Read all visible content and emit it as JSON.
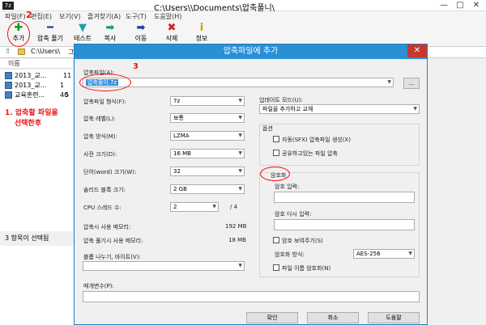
{
  "window": {
    "icon_text": "7z",
    "title": "C:\\Users\\",
    "title_path": "\\Documents\\압축풀니\\",
    "controls": [
      "—",
      "□",
      "✕"
    ]
  },
  "menu": [
    "파일(F)",
    "편집(E)",
    "보기(V)",
    "즐겨찾기(A)",
    "도구(T)",
    "도움말(H)"
  ],
  "toolbar": [
    {
      "label": "추가",
      "icon": "plus-icon",
      "glyph": "✚",
      "color": "#1a9a1a"
    },
    {
      "label": "압축 풀기",
      "icon": "minus-icon",
      "glyph": "━",
      "color": "#1a3aa0"
    },
    {
      "label": "테스트",
      "icon": "check-icon",
      "glyph": "▼",
      "color": "#1aa0b0"
    },
    {
      "label": "복사",
      "icon": "arrow-right-icon",
      "glyph": "➡",
      "color": "#1a9a6a"
    },
    {
      "label": "이동",
      "icon": "arrow-right-icon",
      "glyph": "➡",
      "color": "#1a3aa0"
    },
    {
      "label": "삭제",
      "icon": "delete-icon",
      "glyph": "✖",
      "color": "#d02020"
    },
    {
      "label": "정보",
      "icon": "info-icon",
      "glyph": "i",
      "color": "#d0a000"
    }
  ],
  "address": {
    "path": "C:\\Users\\",
    "path_end": "그"
  },
  "list": {
    "header": "이름",
    "rows": [
      {
        "name": "2013_교...",
        "size": "11"
      },
      {
        "name": "2013_교...",
        "size": "1 40"
      },
      {
        "name": "교육훈련...",
        "size": "5"
      }
    ]
  },
  "annotations": {
    "step1_line1": "1.  압축할  파일을",
    "step1_line2": "선택한후",
    "step2": "2",
    "step3": "3"
  },
  "status": {
    "text": "3 항목이 선택됨"
  },
  "dialog": {
    "title": "압축파일에 추가",
    "close": "✕",
    "archive_label": "압축파일(A):",
    "archive_value": "압축풀이.7z",
    "browse": "...",
    "format_label": "압축파일 형식(F):",
    "format_value": "7z",
    "level_label": "압축 레벨(L):",
    "level_value": "보통",
    "method_label": "압축 방식(M):",
    "method_value": "LZMA",
    "dict_label": "사전 크기(D):",
    "dict_value": "16 MB",
    "word_label": "단어(word) 크기(W):",
    "word_value": "32",
    "solid_label": "솔리드 블록 크기:",
    "solid_value": "2 GB",
    "cpu_label": "CPU 스레드 수:",
    "cpu_value": "2",
    "cpu_total": "/ 4",
    "mem_compress_label": "압축시 사용 메모리:",
    "mem_compress_value": "192 MB",
    "mem_decompress_label": "압축 풀기시 사용 메모리:",
    "mem_decompress_value": "18 MB",
    "split_label": "볼륨 나누기, 바이트(V):",
    "params_label": "매개변수(P):",
    "update_label": "업데이트 모드(U):",
    "update_value": "파일을 추가하고 교체",
    "options_label": "옵션",
    "sfx_label": "자동(SFX) 압축파일 생성(X)",
    "shared_label": "공유하고있는 파일 압축",
    "encrypt_label": "암호화",
    "pw_label": "암호 입력:",
    "pw2_label": "암호 다시 입력:",
    "show_pw_label": "암호 보여주기(S)",
    "enc_method_label": "암호화 방식:",
    "enc_method_value": "AES-256",
    "enc_names_label": "파일 이름 암호화(N)",
    "ok": "확인",
    "cancel": "취소",
    "help": "도움말"
  }
}
